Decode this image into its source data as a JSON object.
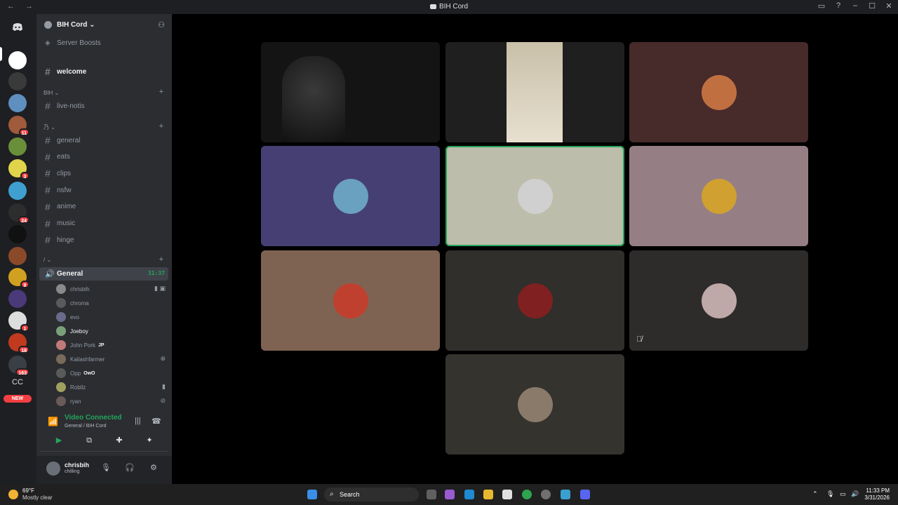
{
  "window": {
    "nav": "← →",
    "title": "BIH Cord",
    "controls": [
      "▭",
      "?",
      "–",
      "☐",
      "✕"
    ]
  },
  "guilds": {
    "items": [
      {
        "name": "home",
        "badge": "",
        "color": "#1e1f22"
      },
      {
        "name": "bih-cord",
        "badge": "",
        "color": "#ffffff"
      },
      {
        "name": "server-2",
        "badge": "",
        "color": "#3a3a3a"
      },
      {
        "name": "server-3",
        "badge": "",
        "color": "#5f8fbf"
      },
      {
        "name": "server-4",
        "badge": "11",
        "color": "#a05a3c"
      },
      {
        "name": "server-5",
        "badge": "",
        "color": "#6a8f3a"
      },
      {
        "name": "server-6",
        "badge": "3",
        "color": "#e0d44a"
      },
      {
        "name": "server-7",
        "badge": "",
        "color": "#3fa0d0"
      },
      {
        "name": "server-8",
        "badge": "24",
        "color": "#2d2d2d"
      },
      {
        "name": "server-9",
        "badge": "",
        "color": "#111111"
      },
      {
        "name": "server-10",
        "badge": "",
        "color": "#8a4a2a"
      },
      {
        "name": "server-11",
        "badge": "9",
        "color": "#d0a020"
      },
      {
        "name": "server-12",
        "badge": "",
        "color": "#4a3a7a"
      },
      {
        "name": "server-13",
        "badge": "1",
        "color": "#dddddd"
      },
      {
        "name": "server-14",
        "badge": "18",
        "color": "#c03a20"
      },
      {
        "name": "server-15",
        "badge": "163",
        "color": "#3a3f46"
      },
      {
        "name": "server-cc",
        "badge": "",
        "color": "#1e1f22"
      }
    ],
    "cc_label": "CC",
    "new_label": "NEW"
  },
  "server": {
    "name": "BIH Cord ⌄",
    "boosts": "Server Boosts",
    "welcome": "welcome",
    "cat1": "BIH ⌄",
    "cat2": "乃 ⌄",
    "cat3": "/ ⌄",
    "channels_a": [
      "live-notis"
    ],
    "channels_b": [
      "general",
      "eats",
      "clips",
      "nsfw",
      "anime",
      "music",
      "hinge"
    ],
    "voice": {
      "name": "General",
      "timer": "31:37"
    },
    "voice_users": [
      {
        "name": "chrisbih",
        "tag": "",
        "right": "▮ ▣",
        "color": "#8a8a8a"
      },
      {
        "name": "chroma",
        "tag": "",
        "right": "",
        "color": "#5a5a5a"
      },
      {
        "name": "evo",
        "tag": "",
        "right": "",
        "color": "#6a6a8a"
      },
      {
        "name": "Joeboy",
        "tag": "",
        "right": "",
        "color": "#7aa07a"
      },
      {
        "name": "John Pork",
        "tag": "JP",
        "right": "",
        "color": "#c07a7a"
      },
      {
        "name": "Kailashfarmer",
        "tag": "",
        "right": "⊗",
        "color": "#7a6a5a"
      },
      {
        "name": "Opp",
        "tag": "OwO",
        "right": "",
        "color": "#5a5a5a"
      },
      {
        "name": "Robllz",
        "tag": "",
        "right": "▮",
        "color": "#a0a060"
      },
      {
        "name": "ryan",
        "tag": "",
        "right": "⊘",
        "color": "#6a5a5a"
      }
    ]
  },
  "rtc": {
    "status": "Video Connected",
    "sub": "General / BIH Cord",
    "buttons": [
      "▶",
      "⧉",
      "✚",
      "✦"
    ]
  },
  "user": {
    "name": "chrisbih",
    "status": "chilling"
  },
  "tiles": [
    {
      "name": "tile-camera-1",
      "bg": "#141414",
      "pfp": "",
      "speaking": false,
      "muted": false
    },
    {
      "name": "tile-camera-2",
      "bg": "#1f1f1f",
      "pfp": "",
      "speaking": false,
      "muted": false
    },
    {
      "name": "tile-3",
      "bg": "#472a2a",
      "pfp": "#c07040",
      "speaking": false,
      "muted": false
    },
    {
      "name": "tile-4",
      "bg": "#463f73",
      "pfp": "#6aa0c0",
      "speaking": false,
      "muted": false
    },
    {
      "name": "tile-5",
      "bg": "#bdbdab",
      "pfp": "#d0d0d0",
      "speaking": true,
      "muted": false
    },
    {
      "name": "tile-6",
      "bg": "#957f85",
      "pfp": "#d0a030",
      "speaking": false,
      "muted": false
    },
    {
      "name": "tile-7",
      "bg": "#7f6352",
      "pfp": "#c04030",
      "speaking": false,
      "muted": false
    },
    {
      "name": "tile-8",
      "bg": "#302f2c",
      "pfp": "#802020",
      "speaking": false,
      "muted": false
    },
    {
      "name": "tile-9",
      "bg": "#2e2b2b",
      "pfp": "#bfa8a8",
      "speaking": false,
      "muted": true
    },
    {
      "name": "tile-10",
      "bg": "#34332e",
      "pfp": "#8a7a6a",
      "speaking": false,
      "muted": false
    }
  ],
  "taskbar": {
    "temp": "69°F",
    "weather": "Mostly clear",
    "search": "Search",
    "time": "11:33 PM",
    "date": "3/31/2026"
  },
  "colors": {
    "accent": "#23a55a",
    "danger": "#f23f43",
    "sidebar": "#2b2d31",
    "rail": "#1e1f22"
  }
}
